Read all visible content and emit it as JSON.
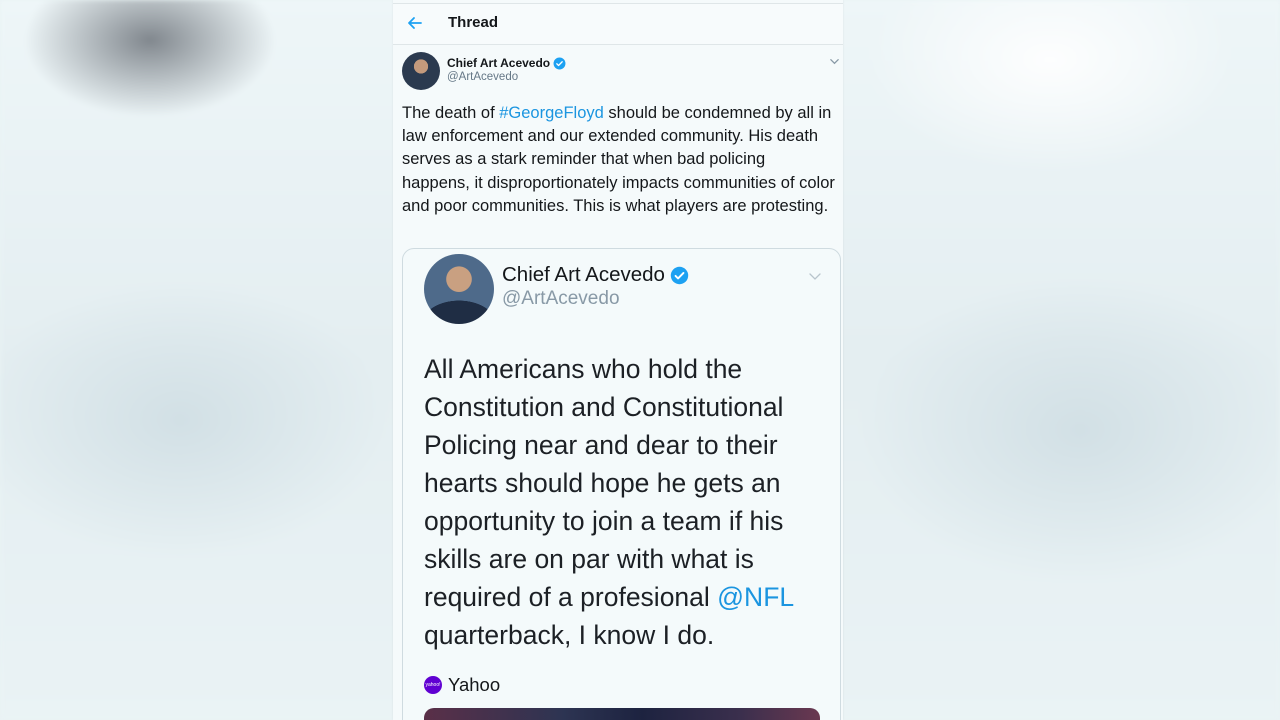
{
  "header": {
    "title": "Thread"
  },
  "tweet": {
    "author_name": "Chief Art Acevedo",
    "author_handle": "@ArtAcevedo",
    "text_before": "The death of ",
    "hashtag": "#GeorgeFloyd",
    "text_after": " should be condemned by all in law enforcement and our extended community. His death serves as a stark reminder that when bad policing happens, it  disproportionately impacts communities of color and poor communities. This is what players are protesting."
  },
  "quoted_tweet": {
    "author_name": "Chief Art Acevedo",
    "author_handle": "@ArtAcevedo",
    "text_before": "All Americans who hold the Constitution and Constitutional Policing near and dear to their hearts should hope he gets an opportunity to join a team if his skills are on par with what is required of a profesional ",
    "mention": "@NFL",
    "text_after": " quarterback, I know I do.",
    "card_source": "Yahoo",
    "card_source_logo_text": "yahoo!"
  },
  "icons": {
    "back": "back-arrow-icon",
    "verified": "verified-badge-icon",
    "more": "chevron-down-icon"
  },
  "colors": {
    "link": "#1b95e0",
    "verified": "#1da1f2",
    "yahoo_purple": "#6001d2"
  }
}
